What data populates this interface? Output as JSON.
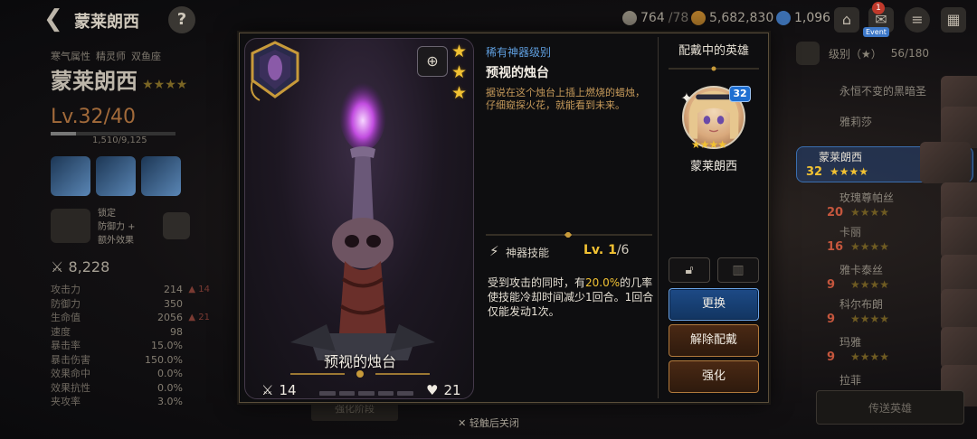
{
  "topbar": {
    "title": "蒙莱朗西",
    "help": "?",
    "stamina": "764",
    "stamina_max": "/78",
    "gold": "5,682,830",
    "crystals": "1,096",
    "notification_count": "1",
    "event_label": "Event"
  },
  "left_panel": {
    "attribute": "寒气属性",
    "class": "精灵师",
    "sign": "双鱼座",
    "hero_name": "蒙莱朗西",
    "level": "Lv.32",
    "level_max": "/40",
    "exp": "1,510/9,125",
    "lock_title": "锁定",
    "lock_line1": "防御力 +",
    "lock_line2": "额外效果",
    "combat_power": "8,228",
    "stats": [
      {
        "name": "攻击力",
        "value": "214",
        "bonus": "▲ 14"
      },
      {
        "name": "防御力",
        "value": "350",
        "bonus": ""
      },
      {
        "name": "生命值",
        "value": "2056",
        "bonus": "▲ 21"
      },
      {
        "name": "速度",
        "value": "98",
        "bonus": ""
      },
      {
        "name": "暴击率",
        "value": "15.0%",
        "bonus": ""
      },
      {
        "name": "暴击伤害",
        "value": "150.0%",
        "bonus": ""
      },
      {
        "name": "效果命中",
        "value": "0.0%",
        "bonus": ""
      },
      {
        "name": "效果抗性",
        "value": "0.0%",
        "bonus": ""
      },
      {
        "name": "夹攻率",
        "value": "3.0%",
        "bonus": ""
      }
    ]
  },
  "right_list": {
    "sort_label": "级别（★）",
    "count": "56/180",
    "heroes": [
      {
        "name": "永恒不变的黑暗圣",
        "level": "",
        "stars": ""
      },
      {
        "name": "雅莉莎",
        "level": "",
        "stars": ""
      },
      {
        "name": "蒙莱朗西",
        "level": "32",
        "stars": "★★★★"
      },
      {
        "name": "玫瑰尊帕丝",
        "level": "20",
        "stars": "★★★★"
      },
      {
        "name": "卡丽",
        "level": "16",
        "stars": "★★★★"
      },
      {
        "name": "雅卡泰丝",
        "level": "9",
        "stars": "★★★★"
      },
      {
        "name": "科尔布朗",
        "level": "9",
        "stars": "★★★★"
      },
      {
        "name": "玛雅",
        "level": "9",
        "stars": "★★★★"
      },
      {
        "name": "拉菲",
        "level": "",
        "stars": ""
      }
    ],
    "transfer_label": "传送英雄"
  },
  "bottom": {
    "close_hint": "轻触后关闭",
    "ghost_button": "强化阶段"
  },
  "artifact": {
    "rarity": "稀有神器级别",
    "title": "预视的烛台",
    "description": "据说在这个烛台上插上燃烧的蜡烛，仔细窥探火花，就能看到未来。",
    "card_name": "预视的烛台",
    "attack": "14",
    "health": "21",
    "stars": [
      "★",
      "★",
      "★"
    ],
    "skill_label": "神器技能",
    "skill_level": "Lv. 1",
    "skill_level_max": "/6",
    "skill_text_1": "受到攻击的同时，有",
    "skill_text_hl": "20.0%",
    "skill_text_2": "的几率使技能冷却时间减少1回合。1回合仅能发动1次。"
  },
  "equipped": {
    "title": "配戴中的英雄",
    "hero_name": "蒙莱朗西",
    "hero_level": "32",
    "hero_stars": "★★★★"
  },
  "buttons": {
    "change": "更换",
    "unequip": "解除配戴",
    "enhance": "强化"
  },
  "colors": {
    "gold_star": "#f2c233",
    "rarity_blue": "#5f9fe0",
    "desc_orange": "#c69a5a",
    "primary_button": "#1d4a86"
  }
}
